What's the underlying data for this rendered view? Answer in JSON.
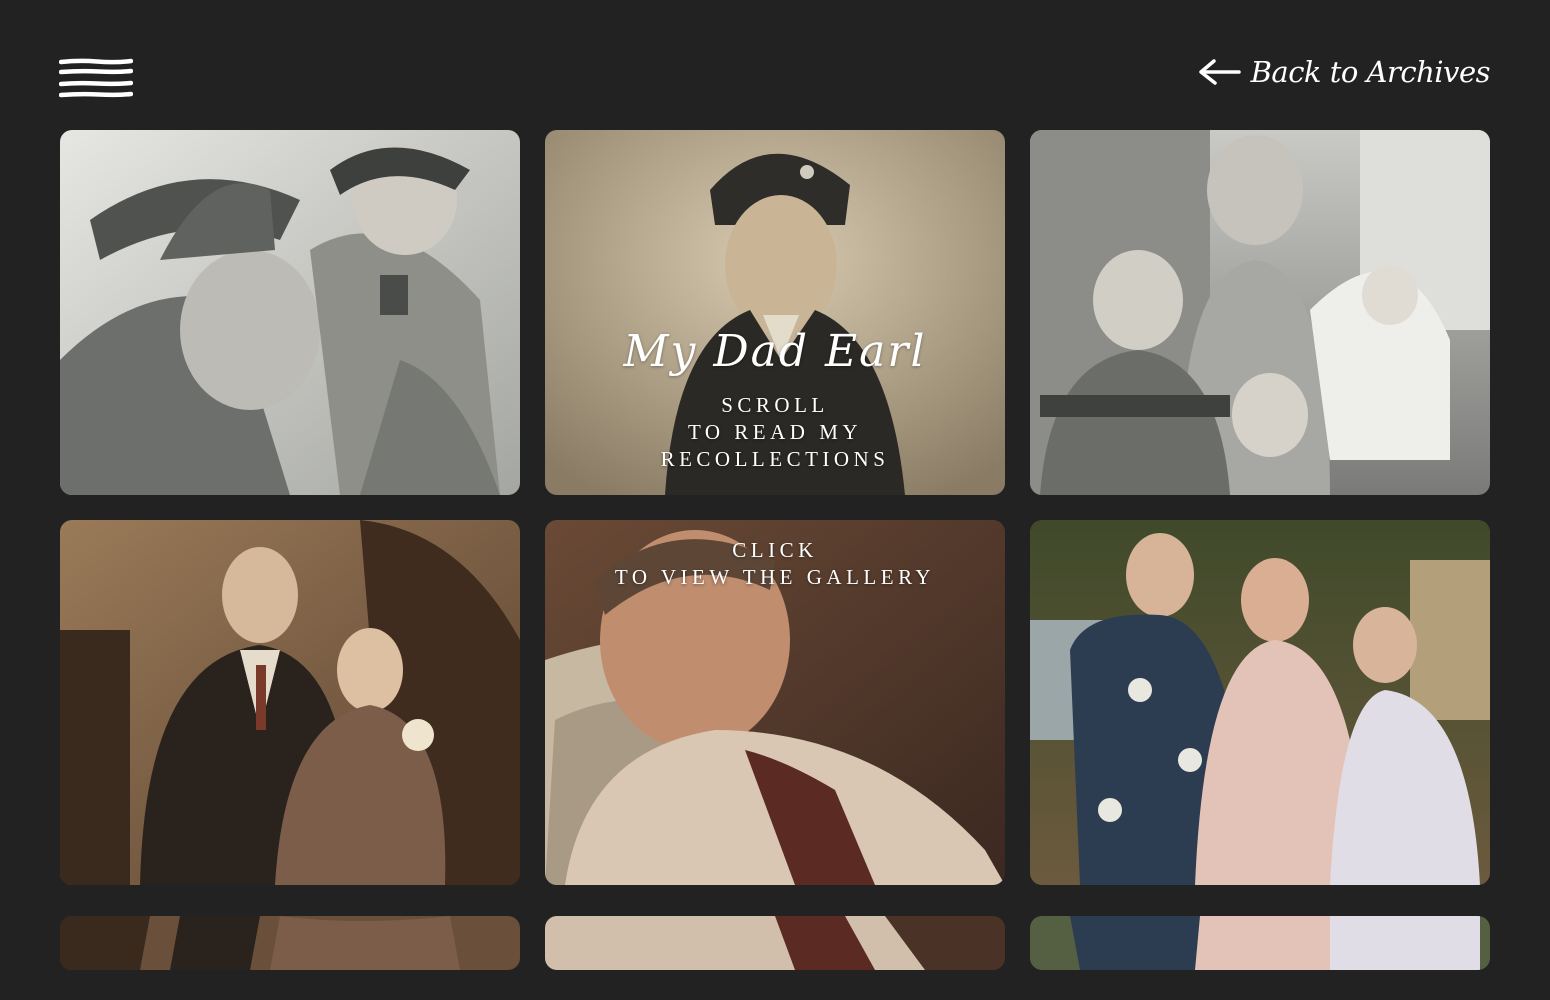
{
  "header": {
    "menu_icon": "hamburger-icon",
    "back_icon": "arrow-left-icon",
    "back_label": "Back to Archives"
  },
  "hero": {
    "title": "My Dad Earl",
    "scroll_line1": "SCROLL",
    "scroll_line2": "TO READ MY",
    "scroll_line3": "RECOLLECTIONS"
  },
  "gallery_hint": {
    "line1": "CLICK",
    "line2": "TO VIEW THE GALLERY"
  },
  "colors": {
    "background": "#222222",
    "text": "#ffffff"
  }
}
